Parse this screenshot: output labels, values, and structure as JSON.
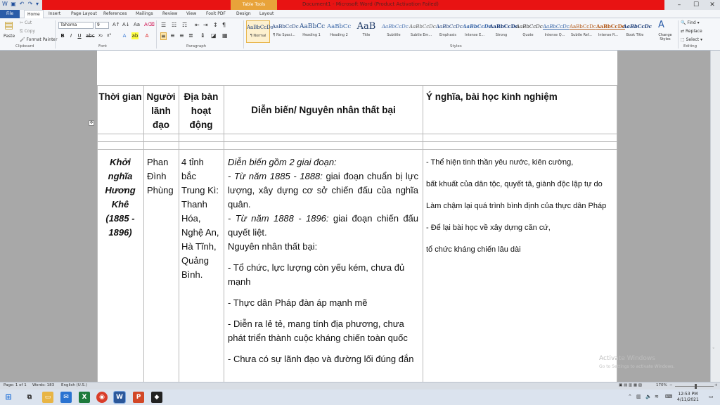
{
  "window": {
    "title": "Document1 - Microsoft Word (Product Activation Failed)",
    "contextual_tab": "Table Tools",
    "controls": [
      "–",
      "☐",
      "✕"
    ]
  },
  "tabs": [
    "File",
    "Home",
    "Insert",
    "Page Layout",
    "References",
    "Mailings",
    "Review",
    "View",
    "Foxit PDF",
    "Design",
    "Layout"
  ],
  "ribbon": {
    "clipboard": {
      "paste": "Paste",
      "cut": "Cut",
      "copy": "Copy",
      "format_painter": "Format Painter",
      "label": "Clipboard"
    },
    "font": {
      "family": "Tahoma",
      "size": "9",
      "label": "Font"
    },
    "paragraph": {
      "label": "Paragraph"
    },
    "styles": {
      "label": "Styles",
      "items": [
        {
          "sample": "AaBbCcDc",
          "name": "¶ Normal"
        },
        {
          "sample": "AaBbCcDc",
          "name": "¶ No Spaci..."
        },
        {
          "sample": "AaBbCc",
          "name": "Heading 1"
        },
        {
          "sample": "AaBbCc",
          "name": "Heading 2"
        },
        {
          "sample": "AaB",
          "name": "Title"
        },
        {
          "sample": "AaBbCcDc",
          "name": "Subtitle"
        },
        {
          "sample": "AaBbCcDc",
          "name": "Subtle Em..."
        },
        {
          "sample": "AaBbCcDc",
          "name": "Emphasis"
        },
        {
          "sample": "AaBbCcDc",
          "name": "Intense E..."
        },
        {
          "sample": "AaBbCcDc",
          "name": "Strong"
        },
        {
          "sample": "AaBbCcDc",
          "name": "Quote"
        },
        {
          "sample": "AaBbCcDc",
          "name": "Intense Q..."
        },
        {
          "sample": "AaBbCcDc",
          "name": "Subtle Ref..."
        },
        {
          "sample": "AaBbCcDc",
          "name": "Intense R..."
        },
        {
          "sample": "AaBbCcDc",
          "name": "Book Title"
        }
      ],
      "change_styles": "Change Styles"
    },
    "editing": {
      "find": "Find",
      "replace": "Replace",
      "select": "Select",
      "label": "Editing"
    }
  },
  "table": {
    "headers": [
      "Thời gian",
      "Người lãnh đạo",
      "Địa bàn hoạt động",
      "Diễn biến/ Nguyên nhân thất bại",
      "Ý nghĩa, bài học kinh nghiệm"
    ],
    "row": {
      "time_lines": [
        "Khởi",
        "nghĩa",
        "Hương",
        "Khê",
        "(1885 -",
        "1896)"
      ],
      "leader_lines": [
        "Phan",
        "Đình",
        "Phùng"
      ],
      "area_lines": [
        "4 tỉnh",
        "bắc",
        "Trung Kì:",
        "Thanh",
        "Hóa,",
        "Nghệ An,",
        "Hà Tĩnh,",
        "Quảng",
        "Bình."
      ],
      "progress_intro": "Diễn biến gồm 2 giai đoạn:",
      "stage1_label": "- Từ năm 1885 - 1888:",
      "stage1_text": " giai đoạn chuẩn bị lực lượng, xây dựng cơ sở chiến đấu của nghĩa quân.",
      "stage2_label": "- Từ năm 1888 - 1896:",
      "stage2_text": " giai đoạn chiến đấu quyết liệt.",
      "causes_title": "Nguyên nhân thất bại:",
      "causes": [
        "- Tổ chức, lực lượng còn yếu kém, chưa đủ mạnh",
        "- Thực dân Pháp đàn áp mạnh mẽ",
        "- Diễn ra lẻ tẻ, mang tính địa phương, chưa phát triển thành cuộc kháng chiến toàn quốc",
        "- Chưa có sự lãnh đạo và đường lối đúng đắn"
      ],
      "meaning": [
        "- Thể hiện tinh thần yêu nước, kiên cường,",
        "bất khuất của dân tộc, quyết tâ, giành độc lập tự do",
        "Làm chậm lại quá trình bình định của thực dân Pháp",
        "- Để lại bài học về xây dựng căn cứ,",
        "tổ chức kháng chiến lâu dài"
      ]
    }
  },
  "status": {
    "page": "Page: 1 of 1",
    "words": "Words: 183",
    "language": "English (U.S.)",
    "zoom": "170%"
  },
  "watermark": {
    "line1": "Activate Windows",
    "line2": "Go to Settings to activate Windows."
  },
  "taskbar": {
    "time": "12:53 PM",
    "date": "4/11/2021"
  }
}
